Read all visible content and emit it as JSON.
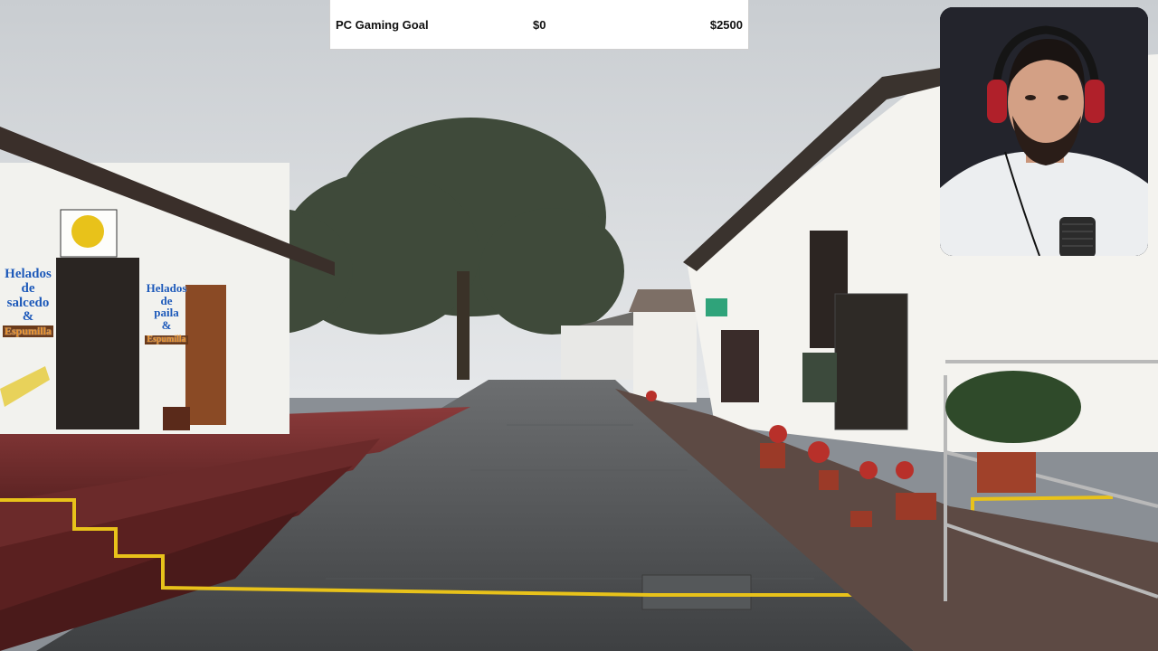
{
  "goal": {
    "title": "PC Gaming Goal",
    "current": "$0",
    "target": "$2500",
    "progress": 0,
    "fill_color": "#4caf50"
  },
  "signs": {
    "left_1": "Helados",
    "left_2": "de",
    "left_3": "salcedo",
    "left_4": "&",
    "left_5": "Espumilla",
    "mid_1": "Helados",
    "mid_2": "de",
    "mid_3": "paila",
    "mid_4": "&",
    "mid_5": "Espumilla"
  },
  "icons": {
    "webcam": "streamer-webcam-icon"
  }
}
